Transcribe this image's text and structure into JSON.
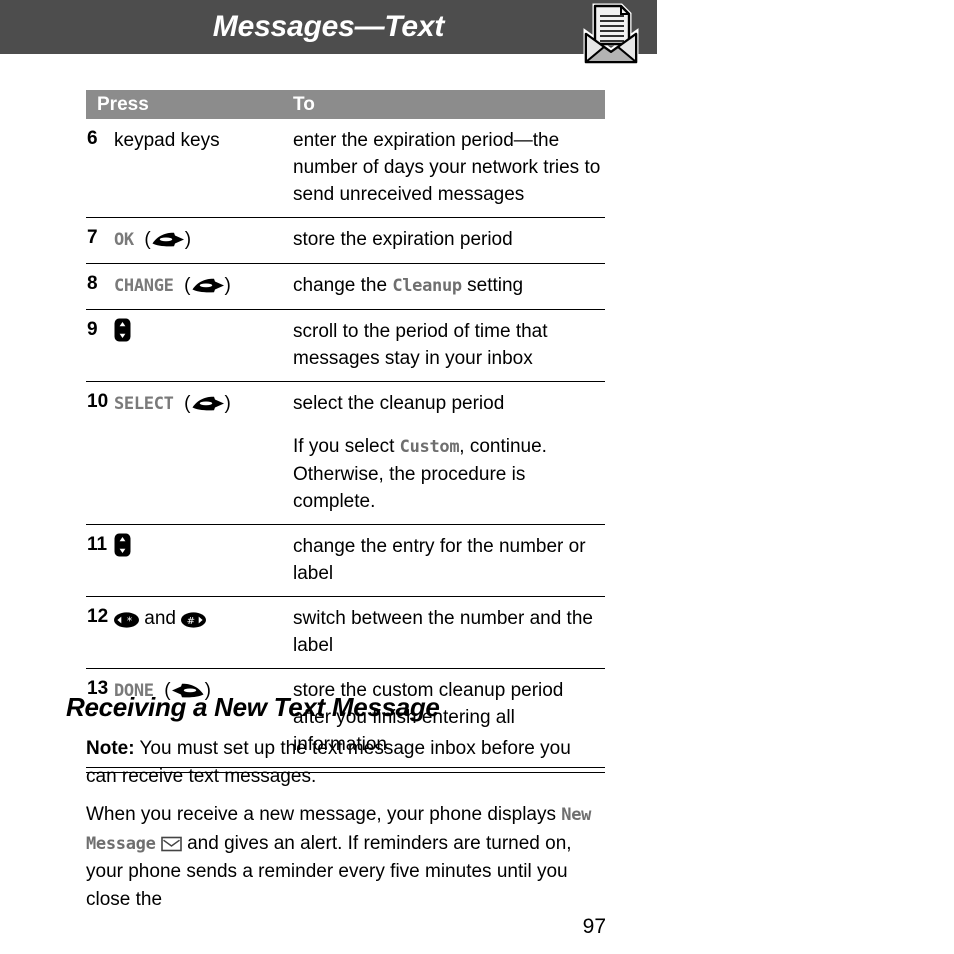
{
  "header": {
    "title": "Messages—Text",
    "icon": "message-envelope-icon"
  },
  "table": {
    "columns": [
      "Press",
      "To"
    ],
    "rows": [
      {
        "num": "6",
        "key_text": "keypad keys",
        "key_icon": "",
        "to": "enter the expiration period—the number of days your network tries to send unreceived messages",
        "to_secondary": ""
      },
      {
        "num": "7",
        "key_text": "OK",
        "key_icon": "softkey-right-icon",
        "to": "store the expiration period",
        "to_secondary": ""
      },
      {
        "num": "8",
        "key_text": "CHANGE",
        "key_icon": "softkey-right-icon",
        "to_pre": "change the ",
        "to_display": "Cleanup",
        "to_post": " setting",
        "to_secondary": ""
      },
      {
        "num": "9",
        "key_text": "",
        "key_icon": "scroll-updown-key-icon",
        "to": "scroll to the period of time that messages stay in your inbox",
        "to_secondary": ""
      },
      {
        "num": "10",
        "key_text": "SELECT",
        "key_icon": "softkey-right-icon",
        "to": "select the cleanup period",
        "to_secondary_pre": "If you select ",
        "to_secondary_display": "Custom",
        "to_secondary_post": ", continue. Otherwise, the procedure is complete."
      },
      {
        "num": "11",
        "key_text": "",
        "key_icon": "scroll-updown-key-icon",
        "to": "change the entry for the number or label",
        "to_secondary": ""
      },
      {
        "num": "12",
        "key_text": "",
        "key_icon": "star-key-icon",
        "key_conjunction": "and",
        "key_icon2": "pound-key-icon",
        "to": "switch between the number and the label",
        "to_secondary": ""
      },
      {
        "num": "13",
        "key_text": "DONE",
        "key_icon": "softkey-left-icon",
        "to": "store the custom cleanup period after you finish entering all information",
        "to_secondary": ""
      }
    ]
  },
  "section": {
    "heading": "Receiving a New Text Message",
    "note_label": "Note:",
    "note_text": " You must set up the text message inbox before you can receive text messages.",
    "body_pre": "When you receive a new message, your phone displays ",
    "body_display1": "New Message",
    "body_post": " and gives an alert. If reminders are turned on, your phone sends a reminder every five minutes until you close the",
    "body_icon": "envelope-outline-icon"
  },
  "footer": {
    "page_number": "97"
  },
  "colors": {
    "header_bar": "#4d4d4d",
    "table_header": "#8c8c8c",
    "display_text": "#7a7a7a",
    "page_bg": "#ffffff"
  }
}
